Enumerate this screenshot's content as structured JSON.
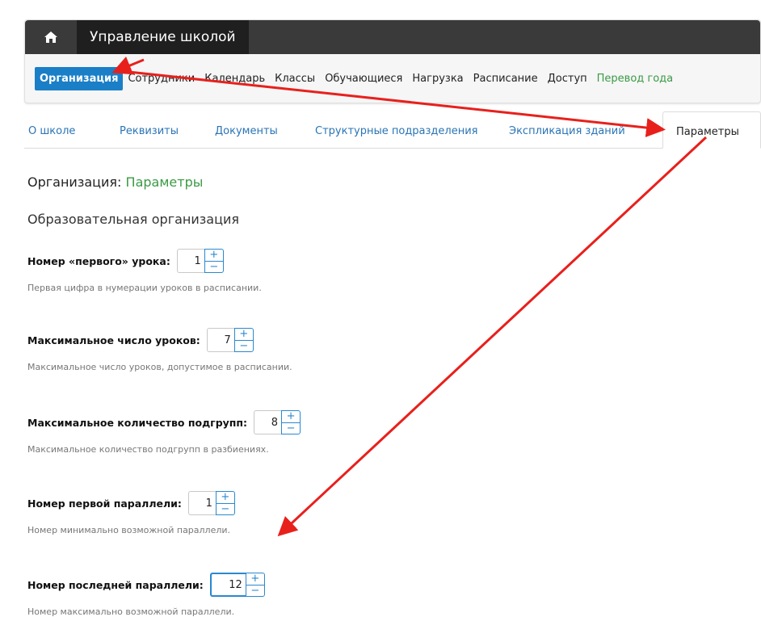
{
  "app": {
    "title": "Управление школой",
    "home_icon": "home-icon"
  },
  "nav": {
    "items": [
      {
        "label": "Организация",
        "active": true
      },
      {
        "label": "Сотрудники"
      },
      {
        "label": "Календарь"
      },
      {
        "label": "Классы"
      },
      {
        "label": "Обучающиеся"
      },
      {
        "label": "Нагрузка"
      },
      {
        "label": "Расписание"
      },
      {
        "label": "Доступ"
      },
      {
        "label": "Перевод года",
        "color": "#3a9a45"
      }
    ]
  },
  "tabs": [
    {
      "label": "О школе"
    },
    {
      "label": "Реквизиты"
    },
    {
      "label": "Документы"
    },
    {
      "label": "Структурные подразделения"
    },
    {
      "label": "Экспликация зданий"
    },
    {
      "label": "Параметры",
      "active": true
    }
  ],
  "page": {
    "heading_prefix": "Организация:",
    "heading_section": "Параметры",
    "subheading": "Образовательная организация"
  },
  "fields": [
    {
      "label": "Номер «первого» урока:",
      "value": "1",
      "hint": "Первая цифра в нумерации уроков в расписании."
    },
    {
      "label": "Максимальное число уроков:",
      "value": "7",
      "hint": "Максимальное число уроков, допустимое в расписании."
    },
    {
      "label": "Максимальное количество подгрупп:",
      "value": "8",
      "hint": "Максимальное количество подгрупп в разбиениях."
    },
    {
      "label": "Номер первой параллели:",
      "value": "1",
      "hint": "Номер минимально возможной параллели."
    },
    {
      "label": "Номер последней параллели:",
      "value": "12",
      "hint": "Номер максимально возможной параллели.",
      "focused": true
    }
  ],
  "stepper": {
    "plus": "+",
    "minus": "−"
  },
  "colors": {
    "accent": "#1a7fc7",
    "green": "#3a9a45",
    "annotation_arrow": "#e8201c",
    "titlebar": "#3a3a3a"
  }
}
